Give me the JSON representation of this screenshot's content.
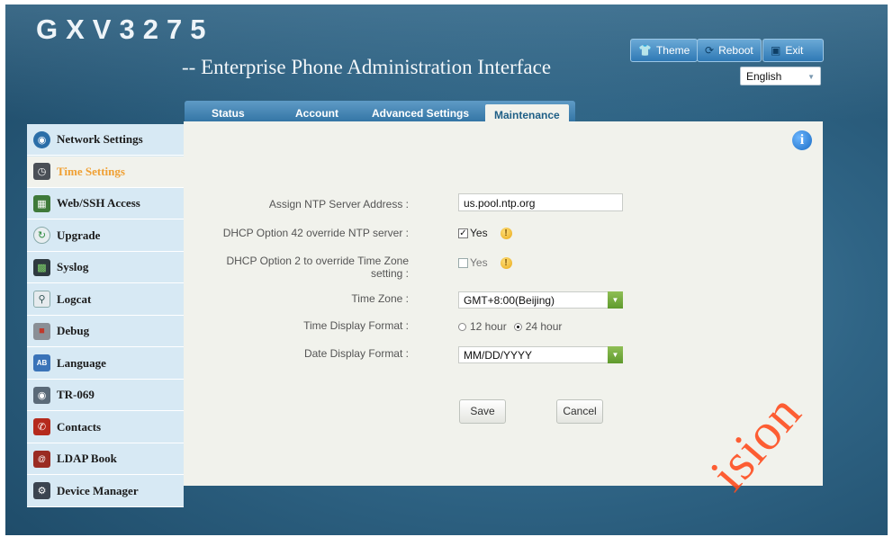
{
  "app": {
    "logo": "GXV3275",
    "subtitle": "-- Enterprise Phone Administration Interface"
  },
  "topbar": {
    "theme_label": "Theme",
    "reboot_label": "Reboot",
    "exit_label": "Exit",
    "language_selected": "English"
  },
  "tabs": [
    {
      "label": "Status"
    },
    {
      "label": "Account"
    },
    {
      "label": "Advanced Settings"
    },
    {
      "label": "Maintenance",
      "active": true
    }
  ],
  "sidebar": {
    "items": [
      {
        "label": "Network Settings",
        "icon": "network-icon"
      },
      {
        "label": "Time Settings",
        "icon": "clock-icon",
        "active": true
      },
      {
        "label": "Web/SSH Access",
        "icon": "web-access-icon"
      },
      {
        "label": "Upgrade",
        "icon": "upgrade-icon"
      },
      {
        "label": "Syslog",
        "icon": "syslog-icon"
      },
      {
        "label": "Logcat",
        "icon": "logcat-icon"
      },
      {
        "label": "Debug",
        "icon": "debug-icon"
      },
      {
        "label": "Language",
        "icon": "language-icon"
      },
      {
        "label": "TR-069",
        "icon": "tr069-icon"
      },
      {
        "label": "Contacts",
        "icon": "contacts-icon"
      },
      {
        "label": "LDAP Book",
        "icon": "ldap-book-icon"
      },
      {
        "label": "Device Manager",
        "icon": "device-manager-icon"
      }
    ]
  },
  "form": {
    "ntp_label": "Assign NTP Server Address :",
    "ntp_value": "us.pool.ntp.org",
    "dhcp42_label": "DHCP Option 42 override NTP server :",
    "dhcp42_option": "Yes",
    "dhcp42_checked": true,
    "dhcp2_label_line1": "DHCP Option 2 to override Time Zone",
    "dhcp2_label_line2": "setting :",
    "dhcp2_option": "Yes",
    "dhcp2_checked": false,
    "timezone_label": "Time Zone :",
    "timezone_value": "GMT+8:00(Beijing)",
    "time_format_label": "Time Display Format :",
    "time_format_12": "12 hour",
    "time_format_24": "24 hour",
    "time_format_selected": "24 hour",
    "date_format_label": "Date Display Format :",
    "date_format_value": "MM/DD/YYYY",
    "save_label": "Save",
    "cancel_label": "Cancel"
  },
  "watermark": "ision",
  "colors": {
    "header_blue": "#2f6485",
    "sidebar_bg": "#d7e9f4",
    "content_bg": "#f1f2ec",
    "active_item_text": "#f0a033",
    "select_arrow_green": "#6aa834",
    "watermark": "#ff4d1f"
  }
}
